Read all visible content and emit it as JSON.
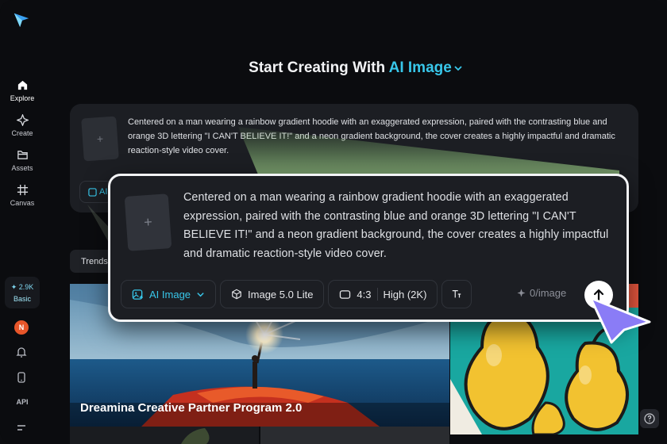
{
  "sidebar": {
    "items": [
      {
        "label": "Explore",
        "icon": "home-icon"
      },
      {
        "label": "Create",
        "icon": "sparkle-icon"
      },
      {
        "label": "Assets",
        "icon": "folder-icon"
      },
      {
        "label": "Canvas",
        "icon": "canvas-icon"
      }
    ],
    "credits": {
      "amount": "2.9K",
      "plan": "Basic"
    },
    "avatar_initial": "N",
    "api_label": "API"
  },
  "headline": {
    "prefix": "Start Creating With",
    "accent": "AI Image"
  },
  "background_prompt": {
    "text": "Centered on a man wearing a rainbow gradient hoodie with an exaggerated expression, paired with the contrasting blue and orange 3D lettering \"I CAN'T BELIEVE IT!\" and a neon gradient background, the cover creates a highly impactful and dramatic reaction-style video cover.",
    "chip_label": "AI"
  },
  "trends_tab": "Trends",
  "gallery": {
    "caption": "Dreamina Creative Partner Program 2.0"
  },
  "prompt_popup": {
    "text": "Centered on a man wearing a rainbow gradient hoodie with an exaggerated expression, paired with the contrasting blue and orange 3D lettering \"I CAN'T BELIEVE IT!\" and a neon gradient background, the cover creates a highly impactful and dramatic reaction-style video cover.",
    "mode": "AI Image",
    "model": "Image 5.0 Lite",
    "ratio": "4:3",
    "quality": "High (2K)",
    "cost": "0/image"
  },
  "colors": {
    "accent": "#38c7ea",
    "background": "#0b0c0f",
    "card": "#1c1e23",
    "cursor": "#8a7cf6"
  }
}
